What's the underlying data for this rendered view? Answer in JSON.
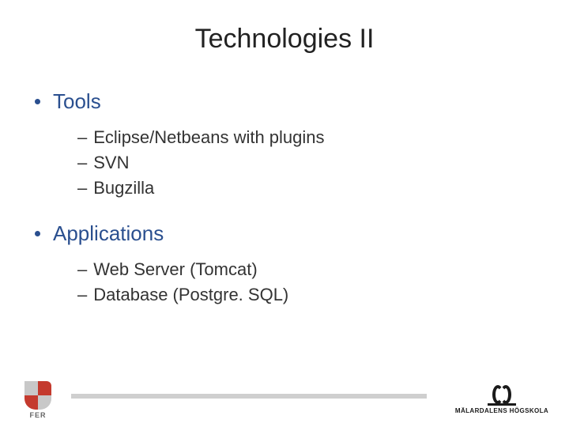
{
  "title": "Technologies II",
  "sections": [
    {
      "heading": "Tools",
      "items": [
        "Eclipse/Netbeans with plugins",
        "SVN",
        "Bugzilla"
      ]
    },
    {
      "heading": " Applications",
      "items": [
        "Web Server (Tomcat)",
        "Database (Postgre. SQL)"
      ]
    }
  ],
  "footer": {
    "left_logo_label": "FER",
    "right_logo_label": "MÄLARDALENS HÖGSKOLA"
  }
}
